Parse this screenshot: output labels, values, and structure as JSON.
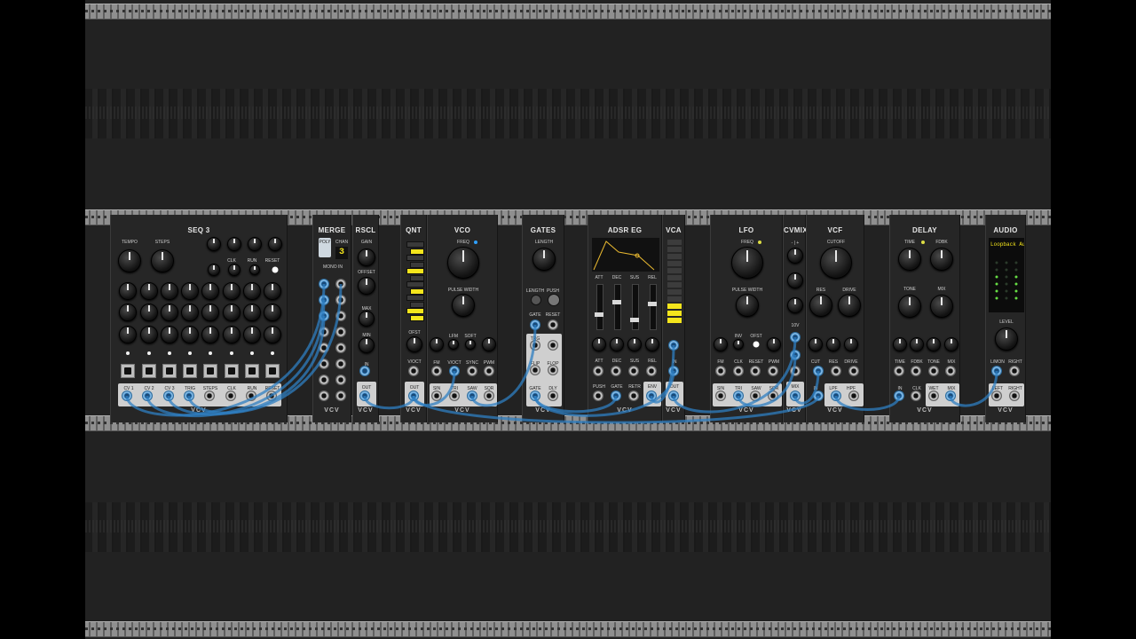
{
  "brand": "VCV",
  "modules": {
    "seq3": {
      "title": "SEQ 3",
      "tempo": "TEMPO",
      "steps": "STEPS",
      "clk": "CLK",
      "run": "RUN",
      "reset": "RESET",
      "cv1": "CV 1",
      "cv2": "CV 2",
      "cv3": "CV 3",
      "trig": "TRIG",
      "steps_out": "STEPS",
      "clk_out": "CLK",
      "run_out": "RUN",
      "reset_out": "RESET"
    },
    "merge": {
      "title": "MERGE",
      "poly": "POLY",
      "chan": "CHAN",
      "chan_value": "3",
      "mono_in": "MONO IN"
    },
    "rscl": {
      "title": "RSCL",
      "gain": "GAIN",
      "offset": "OFFSET",
      "max": "MAX",
      "min": "MIN",
      "in": "IN",
      "out": "OUT"
    },
    "qnt": {
      "title": "QNT",
      "ofst": "OFST",
      "voct": "V/OCT",
      "out": "OUT"
    },
    "vco": {
      "title": "VCO",
      "freq": "FREQ",
      "pulse_width": "PULSE WIDTH",
      "lfm": "LFM",
      "soft": "SOFT",
      "fm": "FM",
      "voct": "V/OCT",
      "sync": "SYNC",
      "pwm": "PWM",
      "sin": "SIN",
      "tri": "TRI",
      "saw": "SAW",
      "sqr": "SQR"
    },
    "gates": {
      "title": "GATES",
      "length": "LENGTH",
      "length2": "LENGTH",
      "push": "PUSH",
      "gate": "GATE",
      "reset": "RESET",
      "trg": "TRG",
      "flip": "FLIP",
      "flop": "FLOP",
      "gate_out": "GATE",
      "dly": "DLY"
    },
    "adsr": {
      "title": "ADSR EG",
      "att": "ATT",
      "dec": "DEC",
      "sus": "SUS",
      "rel": "REL",
      "push": "PUSH",
      "gate": "GATE",
      "retr": "RETR",
      "env": "ENV"
    },
    "vca": {
      "title": "VCA",
      "in": "IN",
      "out": "OUT"
    },
    "lfo": {
      "title": "LFO",
      "freq": "FREQ",
      "pulse_width": "PULSE WIDTH",
      "inv": "INV",
      "ofst": "OFST",
      "fm": "FM",
      "clk": "CLK",
      "reset": "RESET",
      "pwm": "PWM",
      "sin": "SIN",
      "tri": "TRI",
      "saw": "SAW",
      "sqr": "SQR"
    },
    "cvmix": {
      "title": "CVMIX",
      "mix": "MIX",
      "ten": "10V"
    },
    "vcf": {
      "title": "VCF",
      "cutoff": "CUTOFF",
      "res": "RES",
      "drive": "DRIVE",
      "cut": "CUT",
      "in": "IN",
      "lpf": "LPF",
      "hpf": "HPF"
    },
    "delay": {
      "title": "DELAY",
      "time": "TIME",
      "fdbk": "FDBK",
      "tone": "TONE",
      "mix": "MIX",
      "in": "IN",
      "clk": "CLK",
      "wet": "WET",
      "mix_out": "MIX"
    },
    "audio": {
      "title": "AUDIO",
      "device": "Loopback Aud",
      "level": "LEVEL",
      "lmon": "L/MON",
      "right": "RIGHT",
      "left": "LEFT",
      "right_out": "RIGHT"
    }
  },
  "colors": {
    "cable": "#2f7fc1",
    "led_yellow": "#f0d020",
    "led_green": "#66dd44",
    "display_yellow": "#f4e51c"
  }
}
